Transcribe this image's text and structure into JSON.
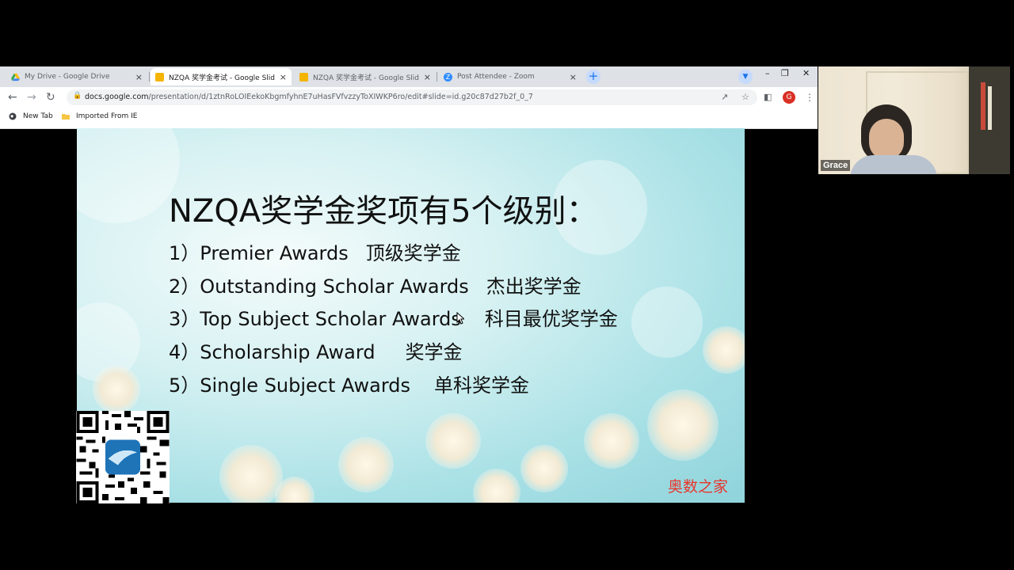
{
  "browser": {
    "tabs": [
      {
        "label": "My Drive - Google Drive",
        "icon": "google-drive-icon",
        "active": false
      },
      {
        "label": "NZQA 奖学金考试 - Google Slide",
        "icon": "google-slides-icon",
        "active": true
      },
      {
        "label": "NZQA 奖学金考试 - Google Slide",
        "icon": "google-slides-icon",
        "active": false
      },
      {
        "label": "Post Attendee - Zoom",
        "icon": "zoom-icon",
        "active": false
      }
    ],
    "close_glyph": "×",
    "new_tab_glyph": "+",
    "url_host": "docs.google.com",
    "url_path": "/presentation/d/1ztnRoLOIEekoKbgmfyhnE7uHasFVfvzzyToXIWKP6ro/edit#slide=id.g20c87d27b2f_0_7",
    "profile_initial": "G",
    "bookmarks": [
      {
        "label": "New Tab",
        "icon": "globe-icon"
      },
      {
        "label": "Imported From IE",
        "icon": "folder-icon"
      }
    ]
  },
  "slide": {
    "title": "NZQA奖学金奖项有5个级别：",
    "awards": [
      {
        "number": "1）",
        "en": "Premier Awards",
        "cn": "顶级奖学金"
      },
      {
        "number": "2）",
        "en": "Outstanding Scholar Awards",
        "cn": "杰出奖学金"
      },
      {
        "number": "3）",
        "en": "Top Subject Scholar Awards",
        "cn": "科目最优奖学金"
      },
      {
        "number": "4）",
        "en": "Scholarship Award",
        "cn": "奖学金"
      },
      {
        "number": "5）",
        "en": "Single Subject Awards",
        "cn": "单科奖学金"
      }
    ],
    "watermark": "奥数之家"
  },
  "video": {
    "participant_name": "Grace"
  },
  "colors": {
    "watermark": "#e8352b",
    "tab_strip": "#dee1e6",
    "accent": "#1a73e8"
  }
}
